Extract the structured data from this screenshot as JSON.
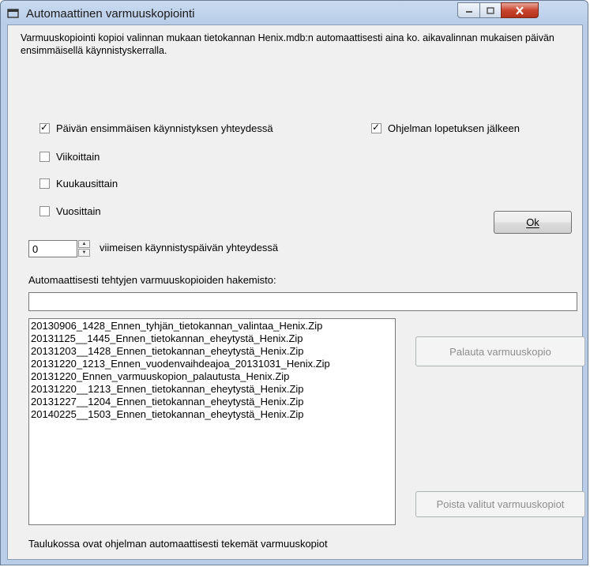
{
  "window": {
    "title": "Automaattinen varmuuskopiointi",
    "icon": "app-window-icon",
    "controls": [
      "minimize-icon",
      "maximize-icon",
      "close-icon"
    ]
  },
  "description": "Varmuuskopiointi kopioi valinnan mukaan tietokannan Henix.mdb:n automaattisesti aina ko. aikavalinnan mukaisen päivän ensimmäisellä käynnistyskerralla.",
  "options": {
    "first_start": {
      "label": "Päivän ensimmäisen käynnistyksen yhteydessä",
      "checked": true
    },
    "after_exit": {
      "label": "Ohjelman lopetuksen jälkeen",
      "checked": true
    },
    "weekly": {
      "label": "Viikoittain",
      "checked": false
    },
    "monthly": {
      "label": "Kuukausittain",
      "checked": false
    },
    "yearly": {
      "label": "Vuosittain",
      "checked": false
    }
  },
  "spinner": {
    "value": "0",
    "label": "viimeisen käynnistyspäivän yhteydessä"
  },
  "ok_button": "Ok",
  "directory": {
    "label": "Automaattisesti tehtyjen varmuuskopioiden hakemisto:",
    "value": ""
  },
  "backups": [
    "20130906_1428_Ennen_tyhjän_tietokannan_valintaa_Henix.Zip",
    "20131125__1445_Ennen_tietokannan_eheytystä_Henix.Zip",
    "20131203__1428_Ennen_tietokannan_eheytystä_Henix.Zip",
    "20131220_1213_Ennen_vuodenvaihdeajoa_20131031_Henix.Zip",
    "20131220_Ennen_varmuuskopion_palautusta_Henix.Zip",
    "20131220__1213_Ennen_tietokannan_eheytystä_Henix.Zip",
    "20131227__1204_Ennen_tietokannan_eheytystä_Henix.Zip",
    "20140225__1503_Ennen_tietokannan_eheytystä_Henix.Zip"
  ],
  "restore_button": "Palauta varmuuskopio",
  "delete_button": "Poista valitut varmuuskopiot",
  "footer": "Taulukossa ovat ohjelman automaattisesti tekemät varmuuskopiot"
}
